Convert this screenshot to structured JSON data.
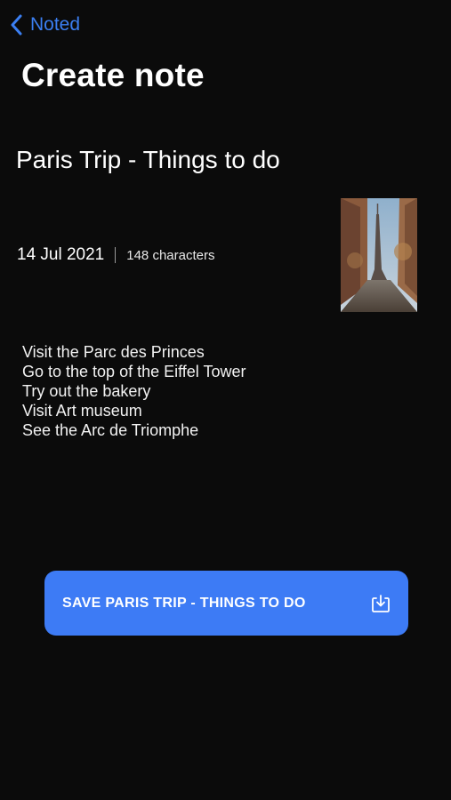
{
  "nav": {
    "back_label": "Noted",
    "back_icon": "chevron-left-icon"
  },
  "page": {
    "title": "Create note"
  },
  "note": {
    "title": "Paris Trip - Things to do",
    "date": "14 Jul 2021",
    "char_count": "148 characters",
    "lines": [
      "Visit the Parc des Princes",
      "Go to the top of the Eiffel Tower",
      "Try out the bakery",
      "Visit Art museum",
      "See the Arc de Triomphe"
    ]
  },
  "save_button": {
    "label": "SAVE PARIS TRIP - THINGS TO DO",
    "icon": "download-icon"
  },
  "colors": {
    "background": "#0b0b0b",
    "accent": "#3d7bf5",
    "back_link": "#3b7ff2",
    "text": "#ffffff"
  }
}
